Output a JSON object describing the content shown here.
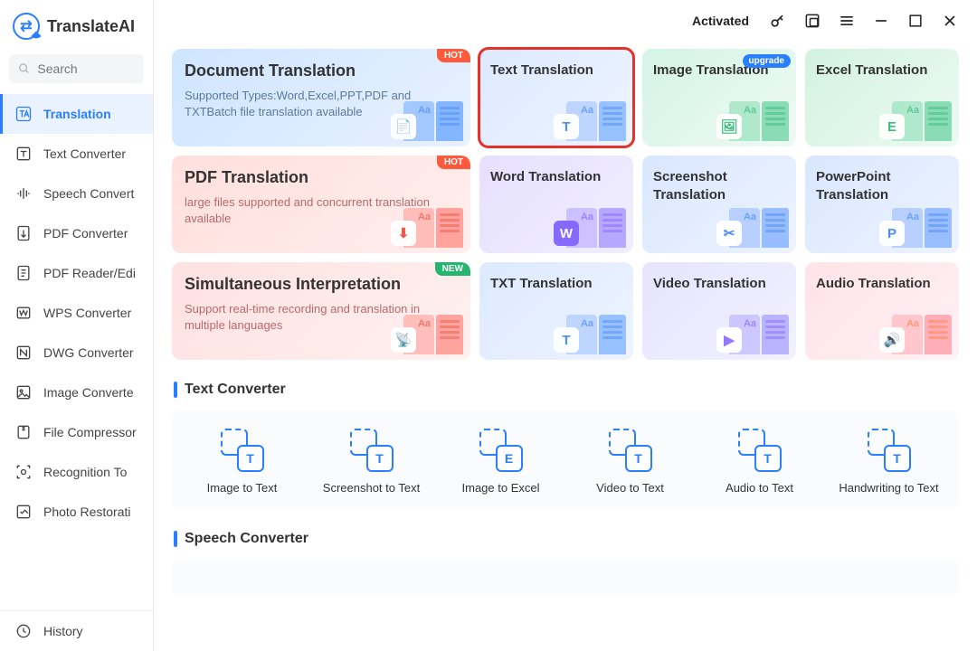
{
  "brand": "TranslateAI",
  "search": {
    "placeholder": "Search"
  },
  "sidebar": {
    "items": [
      {
        "label": "Translation"
      },
      {
        "label": "Text Converter"
      },
      {
        "label": "Speech Convert"
      },
      {
        "label": "PDF Converter"
      },
      {
        "label": "PDF Reader/Edi"
      },
      {
        "label": "WPS Converter"
      },
      {
        "label": "DWG Converter"
      },
      {
        "label": "Image Converte"
      },
      {
        "label": "File Compressor"
      },
      {
        "label": "Recognition To"
      },
      {
        "label": "Photo Restorati"
      }
    ],
    "history": "History"
  },
  "titlebar": {
    "activated": "Activated"
  },
  "badges": {
    "hot": "HOT",
    "new": "NEW",
    "upgrade": "upgrade"
  },
  "cards": {
    "row1": {
      "big": {
        "title": "Document Translation",
        "desc": "Supported Types:Word,Excel,PPT,PDF and TXTBatch file translation available"
      },
      "a": "Text Translation",
      "b": "Image Translation",
      "c": "Excel Translation"
    },
    "row2": {
      "big": {
        "title": "PDF Translation",
        "desc": "large files supported and concurrent translation available"
      },
      "a": "Word Translation",
      "b": "Screenshot Translation",
      "c": "PowerPoint Translation"
    },
    "row3": {
      "big": {
        "title": "Simultaneous Interpretation",
        "desc": "Support real-time recording and translation in multiple languages"
      },
      "a": "TXT Translation",
      "b": "Video Translation",
      "c": "Audio Translation"
    }
  },
  "sections": {
    "text_converter": "Text Converter",
    "speech_converter": "Speech Converter"
  },
  "tools": [
    "Image to Text",
    "Screenshot to Text",
    "Image to Excel",
    "Video to Text",
    "Audio to Text",
    "Handwriting to Text"
  ],
  "icons": {
    "aa": "Aa",
    "T": "T",
    "E": "E",
    "P": "P",
    "W": "W"
  }
}
